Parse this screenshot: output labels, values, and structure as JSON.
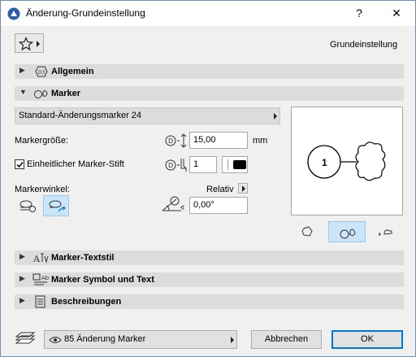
{
  "window": {
    "title": "Änderung-Grundeinstellung",
    "help_label": "?",
    "close_label": "✕"
  },
  "toolbar": {
    "preset_label": "Grundeinstellung"
  },
  "sections": {
    "general": "Allgemein",
    "marker": "Marker",
    "marker_text_style": "Marker-Textstil",
    "marker_symbol_text": "Marker Symbol und Text",
    "descriptions": "Beschreibungen"
  },
  "marker": {
    "type_select": "Standard-Änderungsmarker 24",
    "size_label": "Markergröße:",
    "size_value": "15,00",
    "size_unit": "mm",
    "uniform_pen_label": "Einheitlicher Marker-Stift",
    "uniform_pen_checked": true,
    "pen_value": "1",
    "angle_label": "Markerwinkel:",
    "relative_label": "Relativ",
    "angle_value": "0,00°",
    "preview_number": "1"
  },
  "footer": {
    "layer_value": "85 Änderung Marker",
    "cancel_label": "Abbrechen",
    "ok_label": "OK"
  },
  "colors": {
    "accent": "#0078d7",
    "section_bg": "#dcdcdc",
    "selected_bg": "#cce4f7"
  }
}
